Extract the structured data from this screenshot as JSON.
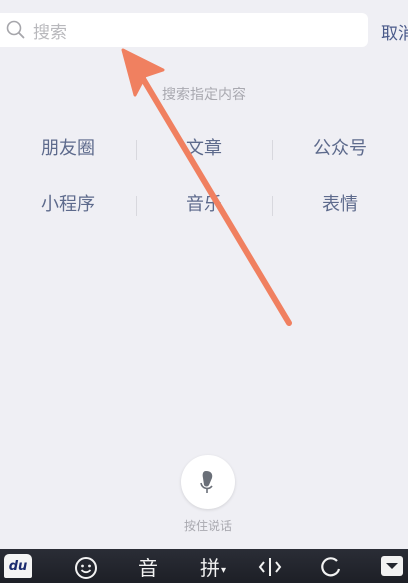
{
  "search": {
    "placeholder": "搜索",
    "cancel_label": "取消"
  },
  "hint": "搜索指定内容",
  "categories": [
    [
      "朋友圈",
      "文章",
      "公众号"
    ],
    [
      "小程序",
      "音乐",
      "表情"
    ]
  ],
  "voice": {
    "label": "按住说话"
  },
  "keyboard_toolbar": {
    "logo_text": "du",
    "voice_char": "音",
    "pinyin_label": "拼",
    "icons": [
      "baidu-logo-icon",
      "emoji-icon",
      "cursor-icon",
      "refresh-icon",
      "keyboard-hide-icon"
    ]
  },
  "colors": {
    "background": "#efeff4",
    "link": "#5d6a8c",
    "annotation_arrow": "#f08060",
    "toolbar": "#23262e"
  }
}
